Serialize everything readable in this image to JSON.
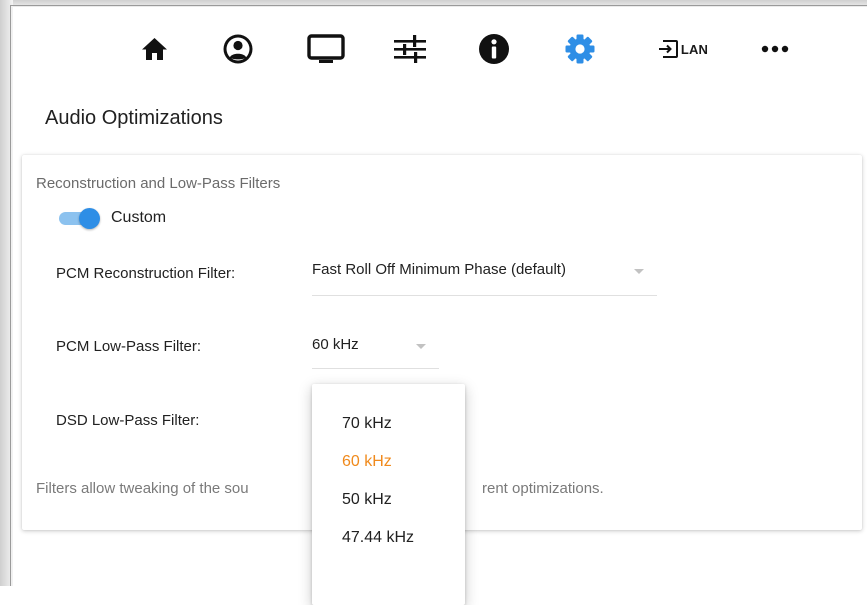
{
  "nav": {
    "items": [
      {
        "icon": "home-icon"
      },
      {
        "icon": "profile-icon"
      },
      {
        "icon": "display-icon"
      },
      {
        "icon": "sliders-icon"
      },
      {
        "icon": "info-icon"
      },
      {
        "icon": "gear-icon",
        "active": true
      },
      {
        "icon": "input-icon",
        "label": "LAN"
      },
      {
        "icon": "more-icon"
      }
    ],
    "active_color": "#2e8ee6"
  },
  "page": {
    "title": "Audio Optimizations"
  },
  "section": {
    "heading": "Reconstruction and Low-Pass Filters",
    "toggle": {
      "label": "Custom",
      "on": true
    },
    "pcm_reconstruction": {
      "label": "PCM Reconstruction Filter:",
      "value": "Fast Roll Off Minimum Phase (default)"
    },
    "pcm_lowpass": {
      "label": "PCM Low-Pass Filter:",
      "value": "60 kHz"
    },
    "dsd_lowpass": {
      "label": "DSD Low-Pass Filter:"
    },
    "help_left": "Filters allow tweaking of the sou",
    "help_right": "rent optimizations."
  },
  "dropdown": {
    "options": [
      "70 kHz",
      "60 kHz",
      "50 kHz",
      "47.44 kHz"
    ],
    "selected": "60 kHz",
    "selected_color": "#f08a1c"
  }
}
